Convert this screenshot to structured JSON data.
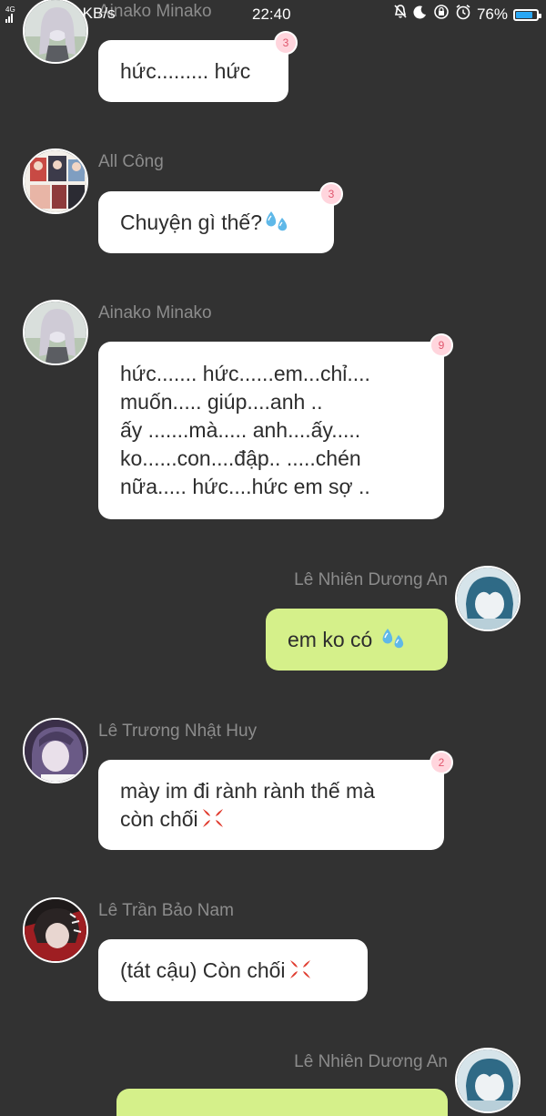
{
  "status_bar": {
    "network": "4G",
    "speed": "KB/s",
    "time": "22:40",
    "battery_percent": "76%",
    "battery_level": 0.76,
    "icons": [
      "mute-bell-icon",
      "moon-icon",
      "rotation-lock-icon",
      "alarm-icon",
      "battery-icon"
    ]
  },
  "messages": [
    {
      "sender": "Ainako Minako",
      "side": "left",
      "text": "hức......... hức",
      "badge": "3",
      "avatar": "avatar-ainako"
    },
    {
      "sender": "All Công",
      "side": "left",
      "text": "Chuyện gì thế?",
      "emoji": "sweat-droplets-icon",
      "badge": "3",
      "avatar": "avatar-all-cong"
    },
    {
      "sender": "Ainako Minako",
      "side": "left",
      "lines": [
        "hức....... hức......em...chỉ....",
        "muốn..... giúp....anh ..",
        "ấy .......mà..... anh....ấy.....",
        "ko......con....đập.. .....chén",
        "nữa..... hức....hức em sợ .."
      ],
      "badge": "9",
      "avatar": "avatar-ainako"
    },
    {
      "sender": "Lê Nhiên Dương An",
      "side": "right",
      "text": "em ko có ",
      "emoji": "sweat-droplets-icon",
      "avatar": "avatar-le-nhien"
    },
    {
      "sender": "Lê Trương Nhật Huy",
      "side": "left",
      "lines": [
        "mày im đi rành rành thế mà",
        "còn chối"
      ],
      "emoji": "anger-symbol-icon",
      "badge": "2",
      "avatar": "avatar-le-truong"
    },
    {
      "sender": "Lê Trần Bảo Nam",
      "side": "left",
      "text": "(tát cậu) Còn chối",
      "emoji": "anger-symbol-icon",
      "avatar": "avatar-le-tran"
    },
    {
      "sender": "Lê Nhiên Dương An",
      "side": "right",
      "text": "",
      "avatar": "avatar-le-nhien"
    }
  ],
  "colors": {
    "background": "#323232",
    "bubble_other": "#ffffff",
    "bubble_mine": "#d5f08a",
    "badge_bg": "#ffd5dd",
    "badge_text": "#e0566d",
    "sender": "#8c8c8c"
  }
}
